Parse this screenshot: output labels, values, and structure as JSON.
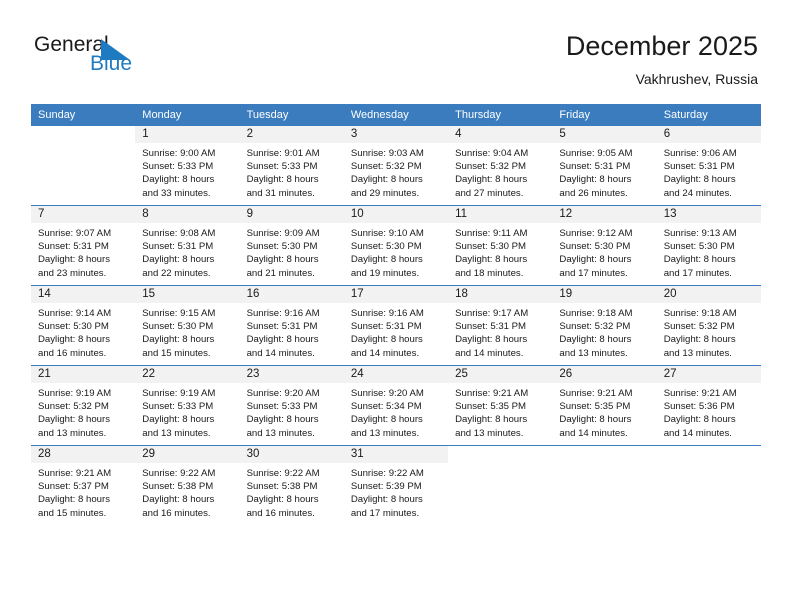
{
  "brand": {
    "name_part1": "General",
    "name_part2": "Blue",
    "flag_icon": "blue-triangle-flag",
    "accent_color": "#1f7bc1"
  },
  "header": {
    "title": "December 2025",
    "subtitle": "Vakhrushev, Russia"
  },
  "theme": {
    "header_bg": "#3a7cbe",
    "daynum_bg": "#f2f2f2",
    "text": "#1a1a1a"
  },
  "weekday_headers": [
    "Sunday",
    "Monday",
    "Tuesday",
    "Wednesday",
    "Thursday",
    "Friday",
    "Saturday"
  ],
  "weeks": [
    [
      {
        "day": "",
        "sunrise": "",
        "sunset": "",
        "daylight1": "",
        "daylight2": "",
        "blank": true
      },
      {
        "day": "1",
        "sunrise": "Sunrise: 9:00 AM",
        "sunset": "Sunset: 5:33 PM",
        "daylight1": "Daylight: 8 hours",
        "daylight2": "and 33 minutes."
      },
      {
        "day": "2",
        "sunrise": "Sunrise: 9:01 AM",
        "sunset": "Sunset: 5:33 PM",
        "daylight1": "Daylight: 8 hours",
        "daylight2": "and 31 minutes."
      },
      {
        "day": "3",
        "sunrise": "Sunrise: 9:03 AM",
        "sunset": "Sunset: 5:32 PM",
        "daylight1": "Daylight: 8 hours",
        "daylight2": "and 29 minutes."
      },
      {
        "day": "4",
        "sunrise": "Sunrise: 9:04 AM",
        "sunset": "Sunset: 5:32 PM",
        "daylight1": "Daylight: 8 hours",
        "daylight2": "and 27 minutes."
      },
      {
        "day": "5",
        "sunrise": "Sunrise: 9:05 AM",
        "sunset": "Sunset: 5:31 PM",
        "daylight1": "Daylight: 8 hours",
        "daylight2": "and 26 minutes."
      },
      {
        "day": "6",
        "sunrise": "Sunrise: 9:06 AM",
        "sunset": "Sunset: 5:31 PM",
        "daylight1": "Daylight: 8 hours",
        "daylight2": "and 24 minutes."
      }
    ],
    [
      {
        "day": "7",
        "sunrise": "Sunrise: 9:07 AM",
        "sunset": "Sunset: 5:31 PM",
        "daylight1": "Daylight: 8 hours",
        "daylight2": "and 23 minutes."
      },
      {
        "day": "8",
        "sunrise": "Sunrise: 9:08 AM",
        "sunset": "Sunset: 5:31 PM",
        "daylight1": "Daylight: 8 hours",
        "daylight2": "and 22 minutes."
      },
      {
        "day": "9",
        "sunrise": "Sunrise: 9:09 AM",
        "sunset": "Sunset: 5:30 PM",
        "daylight1": "Daylight: 8 hours",
        "daylight2": "and 21 minutes."
      },
      {
        "day": "10",
        "sunrise": "Sunrise: 9:10 AM",
        "sunset": "Sunset: 5:30 PM",
        "daylight1": "Daylight: 8 hours",
        "daylight2": "and 19 minutes."
      },
      {
        "day": "11",
        "sunrise": "Sunrise: 9:11 AM",
        "sunset": "Sunset: 5:30 PM",
        "daylight1": "Daylight: 8 hours",
        "daylight2": "and 18 minutes."
      },
      {
        "day": "12",
        "sunrise": "Sunrise: 9:12 AM",
        "sunset": "Sunset: 5:30 PM",
        "daylight1": "Daylight: 8 hours",
        "daylight2": "and 17 minutes."
      },
      {
        "day": "13",
        "sunrise": "Sunrise: 9:13 AM",
        "sunset": "Sunset: 5:30 PM",
        "daylight1": "Daylight: 8 hours",
        "daylight2": "and 17 minutes."
      }
    ],
    [
      {
        "day": "14",
        "sunrise": "Sunrise: 9:14 AM",
        "sunset": "Sunset: 5:30 PM",
        "daylight1": "Daylight: 8 hours",
        "daylight2": "and 16 minutes."
      },
      {
        "day": "15",
        "sunrise": "Sunrise: 9:15 AM",
        "sunset": "Sunset: 5:30 PM",
        "daylight1": "Daylight: 8 hours",
        "daylight2": "and 15 minutes."
      },
      {
        "day": "16",
        "sunrise": "Sunrise: 9:16 AM",
        "sunset": "Sunset: 5:31 PM",
        "daylight1": "Daylight: 8 hours",
        "daylight2": "and 14 minutes."
      },
      {
        "day": "17",
        "sunrise": "Sunrise: 9:16 AM",
        "sunset": "Sunset: 5:31 PM",
        "daylight1": "Daylight: 8 hours",
        "daylight2": "and 14 minutes."
      },
      {
        "day": "18",
        "sunrise": "Sunrise: 9:17 AM",
        "sunset": "Sunset: 5:31 PM",
        "daylight1": "Daylight: 8 hours",
        "daylight2": "and 14 minutes."
      },
      {
        "day": "19",
        "sunrise": "Sunrise: 9:18 AM",
        "sunset": "Sunset: 5:32 PM",
        "daylight1": "Daylight: 8 hours",
        "daylight2": "and 13 minutes."
      },
      {
        "day": "20",
        "sunrise": "Sunrise: 9:18 AM",
        "sunset": "Sunset: 5:32 PM",
        "daylight1": "Daylight: 8 hours",
        "daylight2": "and 13 minutes."
      }
    ],
    [
      {
        "day": "21",
        "sunrise": "Sunrise: 9:19 AM",
        "sunset": "Sunset: 5:32 PM",
        "daylight1": "Daylight: 8 hours",
        "daylight2": "and 13 minutes."
      },
      {
        "day": "22",
        "sunrise": "Sunrise: 9:19 AM",
        "sunset": "Sunset: 5:33 PM",
        "daylight1": "Daylight: 8 hours",
        "daylight2": "and 13 minutes."
      },
      {
        "day": "23",
        "sunrise": "Sunrise: 9:20 AM",
        "sunset": "Sunset: 5:33 PM",
        "daylight1": "Daylight: 8 hours",
        "daylight2": "and 13 minutes."
      },
      {
        "day": "24",
        "sunrise": "Sunrise: 9:20 AM",
        "sunset": "Sunset: 5:34 PM",
        "daylight1": "Daylight: 8 hours",
        "daylight2": "and 13 minutes."
      },
      {
        "day": "25",
        "sunrise": "Sunrise: 9:21 AM",
        "sunset": "Sunset: 5:35 PM",
        "daylight1": "Daylight: 8 hours",
        "daylight2": "and 13 minutes."
      },
      {
        "day": "26",
        "sunrise": "Sunrise: 9:21 AM",
        "sunset": "Sunset: 5:35 PM",
        "daylight1": "Daylight: 8 hours",
        "daylight2": "and 14 minutes."
      },
      {
        "day": "27",
        "sunrise": "Sunrise: 9:21 AM",
        "sunset": "Sunset: 5:36 PM",
        "daylight1": "Daylight: 8 hours",
        "daylight2": "and 14 minutes."
      }
    ],
    [
      {
        "day": "28",
        "sunrise": "Sunrise: 9:21 AM",
        "sunset": "Sunset: 5:37 PM",
        "daylight1": "Daylight: 8 hours",
        "daylight2": "and 15 minutes."
      },
      {
        "day": "29",
        "sunrise": "Sunrise: 9:22 AM",
        "sunset": "Sunset: 5:38 PM",
        "daylight1": "Daylight: 8 hours",
        "daylight2": "and 16 minutes."
      },
      {
        "day": "30",
        "sunrise": "Sunrise: 9:22 AM",
        "sunset": "Sunset: 5:38 PM",
        "daylight1": "Daylight: 8 hours",
        "daylight2": "and 16 minutes."
      },
      {
        "day": "31",
        "sunrise": "Sunrise: 9:22 AM",
        "sunset": "Sunset: 5:39 PM",
        "daylight1": "Daylight: 8 hours",
        "daylight2": "and 17 minutes."
      },
      {
        "day": "",
        "sunrise": "",
        "sunset": "",
        "daylight1": "",
        "daylight2": "",
        "blank": true
      },
      {
        "day": "",
        "sunrise": "",
        "sunset": "",
        "daylight1": "",
        "daylight2": "",
        "blank": true
      },
      {
        "day": "",
        "sunrise": "",
        "sunset": "",
        "daylight1": "",
        "daylight2": "",
        "blank": true
      }
    ]
  ]
}
